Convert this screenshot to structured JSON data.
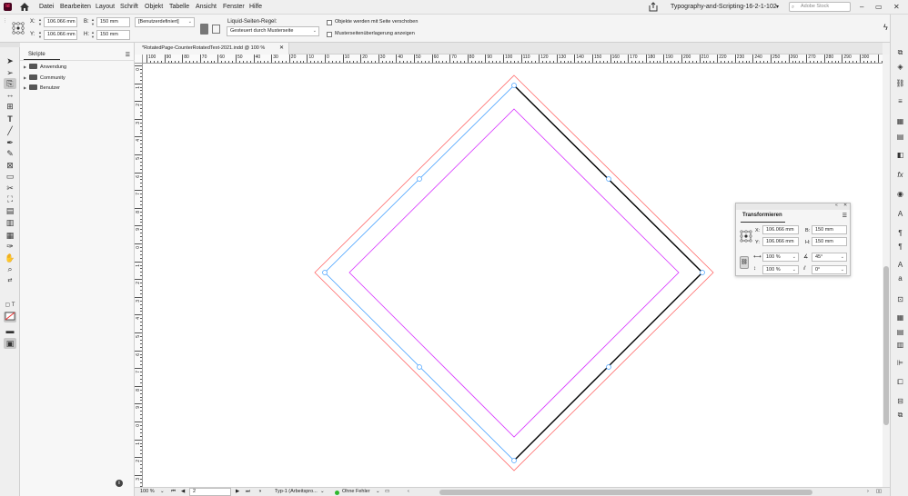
{
  "menubar": {
    "logo": "Id",
    "items": [
      "Datei",
      "Bearbeiten",
      "Layout",
      "Schrift",
      "Objekt",
      "Tabelle",
      "Ansicht",
      "Fenster",
      "Hilfe"
    ],
    "document_title": "Typography-and-Scripting-16-2-1-102",
    "search_placeholder": "Adobe Stock"
  },
  "control": {
    "x_label": "X:",
    "x_value": "106.066 mm",
    "y_label": "Y:",
    "y_value": "106.066 mm",
    "w_label": "B:",
    "w_value": "150 mm",
    "h_label": "H:",
    "h_value": "150 mm",
    "preset_value": "[Benutzerdefiniert]",
    "liquid_label": "Liquid-Seiten-Regel:",
    "liquid_value": "Gesteuert durch Musterseite",
    "check1_label": "Objekte werden mit Seite verschoben",
    "check2_label": "Musterseitenüberlagerung anzeigen"
  },
  "scripts_panel": {
    "tab_label": "Skripte",
    "folders": [
      "Anwendung",
      "Community",
      "Benutzer"
    ]
  },
  "document": {
    "tab_label": "*RotatedPage-CounterRotatedText-2021.indd @ 100 %",
    "ruler_top": [
      "100",
      "90",
      "80",
      "70",
      "60",
      "50",
      "40",
      "30",
      "20",
      "10",
      "0",
      "10",
      "20",
      "30",
      "40",
      "50",
      "60",
      "70",
      "80",
      "90",
      "100",
      "110",
      "120",
      "130",
      "140",
      "150",
      "160",
      "170",
      "180",
      "190",
      "200",
      "210",
      "220",
      "230",
      "240",
      "250",
      "260",
      "270",
      "280",
      "290",
      "300"
    ],
    "ruler_left": [
      "0",
      "1",
      "2",
      "3",
      "4",
      "5",
      "6",
      "7",
      "8",
      "9",
      "0",
      "1",
      "2",
      "3",
      "4",
      "5",
      "6",
      "7",
      "8",
      "9",
      "0",
      "1",
      "2",
      "3"
    ]
  },
  "statusbar": {
    "zoom": "100 %",
    "page": "2",
    "preflight_profile": "Typ-1 (Arbeitspro...",
    "errors": "Ohne Fehler"
  },
  "transform_panel": {
    "title": "Transformieren",
    "x_label": "X:",
    "x_value": "106.066 mm",
    "y_label": "Y:",
    "y_value": "106.066 mm",
    "w_label": "B:",
    "w_value": "150 mm",
    "h_label": "H:",
    "h_value": "150 mm",
    "scale_x": "100 %",
    "scale_y": "100 %",
    "rotation": "45°",
    "shear": "0°"
  },
  "colors": {
    "bleed": "#ff6b6b",
    "page_edge": "#000000",
    "margin": "#d733ff",
    "frame": "#4aa3ff",
    "status_ok": "#2eb82e"
  }
}
